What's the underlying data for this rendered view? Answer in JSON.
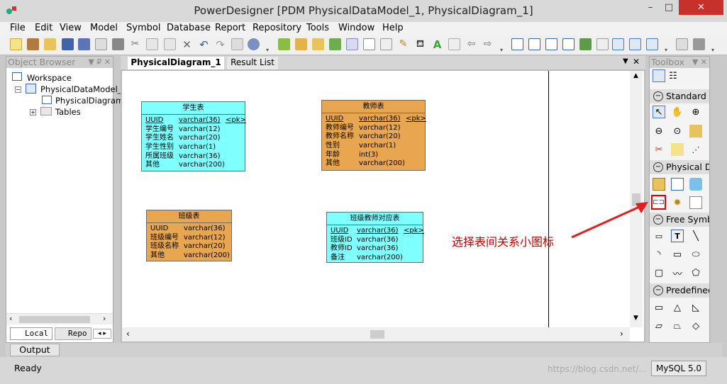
{
  "window": {
    "title": "PowerDesigner [PDM PhysicalDataModel_1, PhysicalDiagram_1]",
    "min": "–",
    "max": "□",
    "close": "✕"
  },
  "menu": [
    "File",
    "Edit",
    "View",
    "Model",
    "Symbol",
    "Database",
    "Report",
    "Repository",
    "Tools",
    "Window",
    "Help"
  ],
  "object_browser": {
    "title": "Object Browser",
    "pin": "▼ ₽ ✕",
    "items": {
      "workspace": "Workspace",
      "model": "PhysicalDataModel_",
      "diagram": "PhysicalDiagram",
      "tables": "Tables"
    },
    "tabs": {
      "local": "Local",
      "repo": "Repo"
    }
  },
  "doc_tabs": {
    "diagram": "PhysicalDiagram_1",
    "result": "Result List"
  },
  "tables": {
    "student": {
      "name": "学生表",
      "rows": [
        [
          "UUID",
          "varchar(36)",
          "<pk>"
        ],
        [
          "学生编号",
          "varchar(12)",
          ""
        ],
        [
          "学生姓名",
          "varchar(20)",
          ""
        ],
        [
          "学生性别",
          "varchar(1)",
          ""
        ],
        [
          "所属班级",
          "varchar(36)",
          ""
        ],
        [
          "其他",
          "varchar(200)",
          ""
        ]
      ]
    },
    "teacher": {
      "name": "教师表",
      "rows": [
        [
          "UUID",
          "varchar(36)",
          "<pk>"
        ],
        [
          "教师编号",
          "varchar(12)",
          ""
        ],
        [
          "教师名称",
          "varchar(20)",
          ""
        ],
        [
          "性别",
          "varchar(1)",
          ""
        ],
        [
          "年龄",
          "int(3)",
          ""
        ],
        [
          "其他",
          "varchar(200)",
          ""
        ]
      ]
    },
    "class": {
      "name": "班级表",
      "rows": [
        [
          "UUID",
          "varchar(36)",
          ""
        ],
        [
          "班级编号",
          "varchar(12)",
          ""
        ],
        [
          "班级名称",
          "varchar(20)",
          ""
        ],
        [
          "其他",
          "varchar(200)",
          ""
        ]
      ]
    },
    "map": {
      "name": "班级教师对应表",
      "rows": [
        [
          "UUID",
          "varchar(36)",
          "<pk>"
        ],
        [
          "班级ID",
          "varchar(36)",
          ""
        ],
        [
          "教师ID",
          "varchar(36)",
          ""
        ],
        [
          "备注",
          "varchar(200)",
          ""
        ]
      ]
    }
  },
  "annotation": "选择表间关系小图标",
  "toolbox": {
    "title": "Toolbox",
    "sections": {
      "standard": "Standard",
      "physical": "Physical D",
      "free": "Free Symb",
      "predefined": "Predefined"
    }
  },
  "output_tab": "Output",
  "status": {
    "left": "Ready",
    "db": "MySQL 5.0",
    "watermark": "https://blog.csdn.net/..."
  },
  "colors": {
    "cyan": "#80ffff",
    "orange": "#e8a650",
    "annotation": "#c00000"
  }
}
